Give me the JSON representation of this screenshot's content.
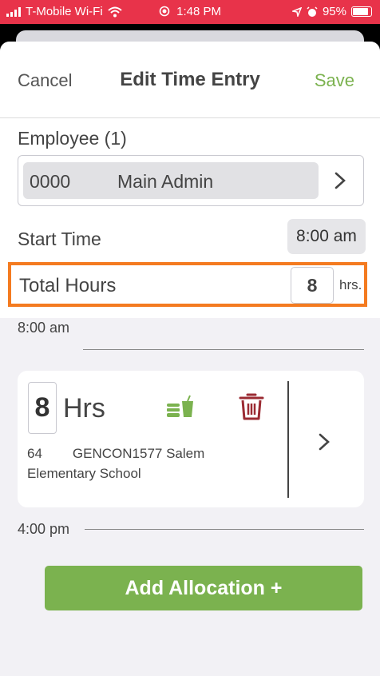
{
  "status_bar": {
    "carrier": "T-Mobile Wi-Fi",
    "time": "1:48 PM",
    "battery": "95%",
    "background_color": "#e8334a"
  },
  "header": {
    "cancel_label": "Cancel",
    "title": "Edit Time Entry",
    "save_label": "Save"
  },
  "employee": {
    "label": "Employee (1)",
    "id": "0000",
    "name": "Main Admin"
  },
  "start_time": {
    "label": "Start Time",
    "value": "8:00 am"
  },
  "total_hours": {
    "label": "Total Hours",
    "value": "8",
    "unit": "hrs."
  },
  "timeline": {
    "start": "8:00 am",
    "end": "4:00 pm"
  },
  "allocation": {
    "hours": "8",
    "unit": "Hrs",
    "number": "64",
    "code": "GENCON1577 Salem",
    "location": "Elementary School",
    "icons": [
      "meal-icon",
      "trash-icon",
      "chevron-right-icon"
    ]
  },
  "add_allocation_label": "Add Allocation +",
  "colors": {
    "accent_green": "#7bb24f",
    "highlight_orange": "#f47b20",
    "trash_red": "#9b2b33"
  }
}
